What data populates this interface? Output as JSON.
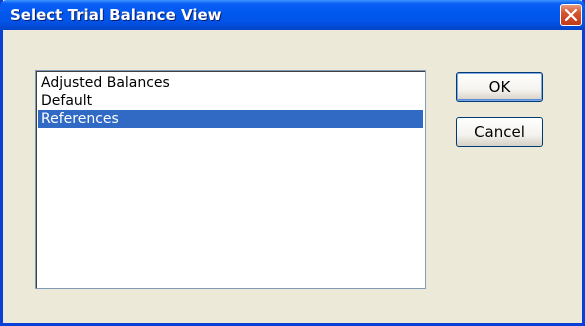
{
  "window": {
    "title": "Select Trial Balance View"
  },
  "list": {
    "items": [
      {
        "label": "Adjusted Balances",
        "selected": false
      },
      {
        "label": "Default",
        "selected": false
      },
      {
        "label": "References",
        "selected": true
      }
    ]
  },
  "buttons": {
    "ok_label": "OK",
    "cancel_label": "Cancel"
  },
  "icons": {
    "close": "close-icon"
  },
  "colors": {
    "titlebar": "#0058ee",
    "selection": "#316ac5",
    "close_button": "#d4542e",
    "dialog_background": "#ece9d8"
  }
}
